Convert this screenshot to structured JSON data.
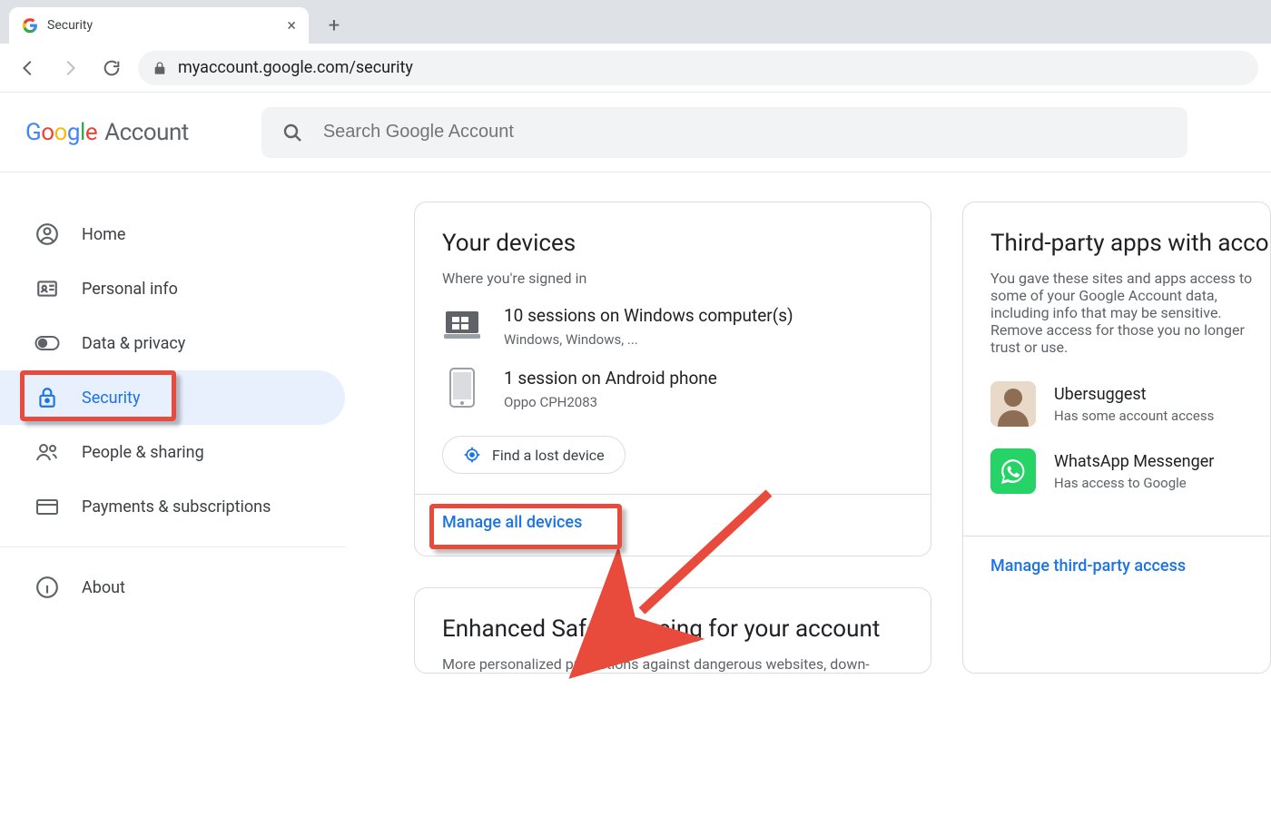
{
  "browser": {
    "tab_title": "Security",
    "url": "myaccount.google.com/security"
  },
  "header": {
    "logo_primary": "Google",
    "logo_secondary": "Account",
    "search_placeholder": "Search Google Account"
  },
  "sidebar": {
    "items": [
      {
        "label": "Home"
      },
      {
        "label": "Personal info"
      },
      {
        "label": "Data & privacy"
      },
      {
        "label": "Security"
      },
      {
        "label": "People & sharing"
      },
      {
        "label": "Payments & subscriptions"
      }
    ],
    "about_label": "About"
  },
  "devices_card": {
    "title": "Your devices",
    "subtitle": "Where you're signed in",
    "rows": [
      {
        "title": "10 sessions on Windows computer(s)",
        "sub": "Windows, Windows, ..."
      },
      {
        "title": "1 session on Android phone",
        "sub": "Oppo CPH2083"
      }
    ],
    "find_label": "Find a lost device",
    "manage_label": "Manage all devices"
  },
  "thirdparty_card": {
    "title": "Third-party apps with account access",
    "desc": "You gave these sites and apps access to some of your Google Account data, including info that may be sensitive. Remove access for those you no longer trust or use.",
    "apps": [
      {
        "name": "Ubersuggest",
        "sub": "Has some account access"
      },
      {
        "name": "WhatsApp Messenger",
        "sub": "Has access to Google"
      }
    ],
    "manage_label": "Manage third-party access"
  },
  "safe_browsing": {
    "title": "Enhanced Safe Browsing for your account",
    "sub": "More personalized protections against dangerous websites, down-"
  }
}
